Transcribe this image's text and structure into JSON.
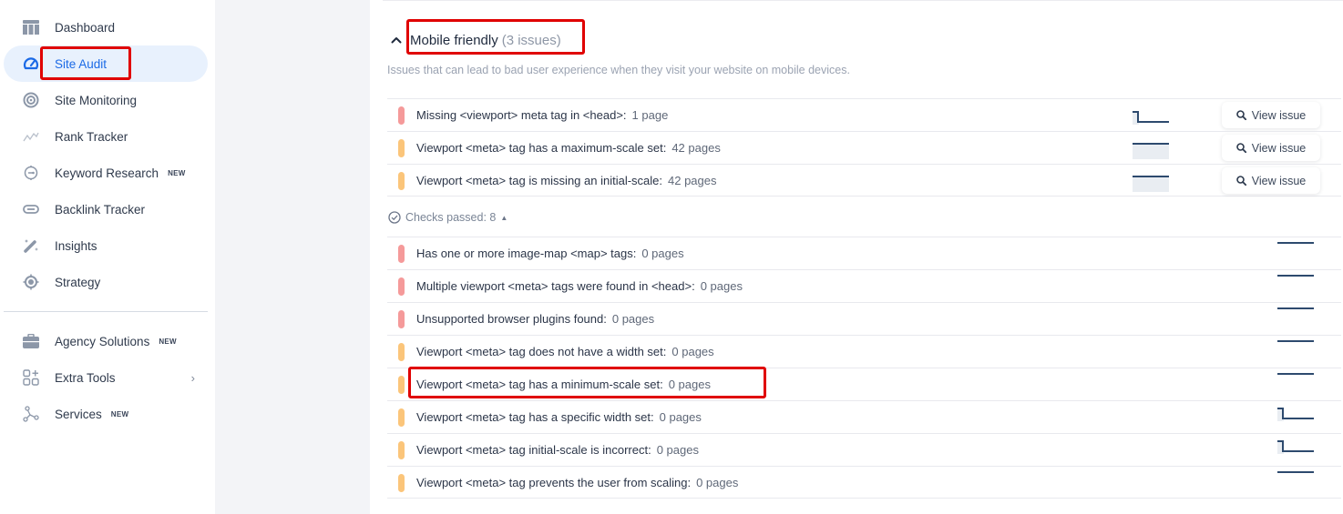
{
  "sidebar": {
    "items": [
      {
        "label": "Dashboard",
        "icon": "dashboard-icon",
        "active": false,
        "badge": ""
      },
      {
        "label": "Site Audit",
        "icon": "gauge-icon",
        "active": true,
        "badge": ""
      },
      {
        "label": "Site Monitoring",
        "icon": "monitoring-icon",
        "active": false,
        "badge": ""
      },
      {
        "label": "Rank Tracker",
        "icon": "trend-line-icon",
        "active": false,
        "badge": ""
      },
      {
        "label": "Keyword Research",
        "icon": "keyword-icon",
        "active": false,
        "badge": "NEW"
      },
      {
        "label": "Backlink Tracker",
        "icon": "link-icon",
        "active": false,
        "badge": ""
      },
      {
        "label": "Insights",
        "icon": "magic-wand-icon",
        "active": false,
        "badge": ""
      },
      {
        "label": "Strategy",
        "icon": "target-icon",
        "active": false,
        "badge": ""
      }
    ],
    "secondary_items": [
      {
        "label": "Agency Solutions",
        "icon": "briefcase-icon",
        "badge": "NEW",
        "chevron": false
      },
      {
        "label": "Extra Tools",
        "icon": "apps-plus-icon",
        "badge": "",
        "chevron": true
      },
      {
        "label": "Services",
        "icon": "nodes-icon",
        "badge": "NEW",
        "chevron": false
      }
    ]
  },
  "section": {
    "title": "Mobile friendly",
    "count": "(3 issues)",
    "description": "Issues that can lead to bad user experience when they visit your website on mobile devices.",
    "view_button_label": "View issue",
    "issues": [
      {
        "label": "Missing <viewport> meta tag in <head>:",
        "count": "1 page",
        "severity": "error",
        "trend": "drop"
      },
      {
        "label": "Viewport <meta> tag has a maximum-scale set:",
        "count": "42 pages",
        "severity": "warning",
        "trend": "flat-filled"
      },
      {
        "label": "Viewport <meta> tag is missing an initial-scale:",
        "count": "42 pages",
        "severity": "warning",
        "trend": "flat-filled"
      }
    ],
    "checks_passed_label": "Checks passed: 8",
    "passed": [
      {
        "label": "Has one or more image-map <map> tags:",
        "count": "0 pages",
        "severity": "error",
        "trend": "flat"
      },
      {
        "label": "Multiple viewport <meta> tags were found in <head>:",
        "count": "0 pages",
        "severity": "error",
        "trend": "flat"
      },
      {
        "label": "Unsupported browser plugins found:",
        "count": "0 pages",
        "severity": "error",
        "trend": "flat"
      },
      {
        "label": "Viewport <meta> tag does not have a width set:",
        "count": "0 pages",
        "severity": "warning",
        "trend": "flat"
      },
      {
        "label": "Viewport <meta> tag has a minimum-scale set:",
        "count": "0 pages",
        "severity": "warning",
        "trend": "flat"
      },
      {
        "label": "Viewport <meta> tag has a specific width set:",
        "count": "0 pages",
        "severity": "warning",
        "trend": "drop"
      },
      {
        "label": "Viewport <meta> tag initial-scale is incorrect:",
        "count": "0 pages",
        "severity": "warning",
        "trend": "drop"
      },
      {
        "label": "Viewport <meta> tag prevents the user from scaling:",
        "count": "0 pages",
        "severity": "warning",
        "trend": "flat"
      }
    ]
  },
  "colors": {
    "accent": "#1b6ae6",
    "active_bg": "#e8f1fd",
    "error": "#f59a9a",
    "warning": "#fbc57a",
    "sparkline": "#2d4a6e",
    "highlight": "#e00000"
  }
}
